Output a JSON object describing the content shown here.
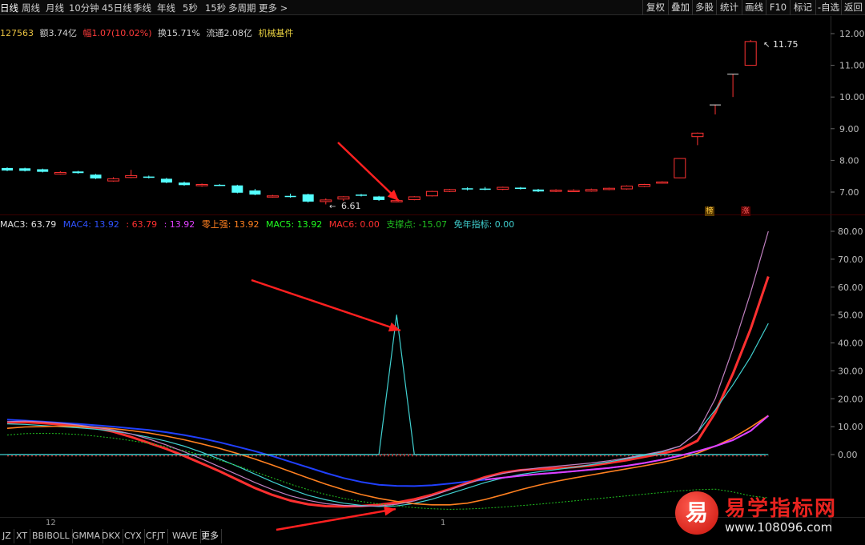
{
  "toolbar": {
    "periods": [
      "日线",
      "周线",
      "月线",
      "10分钟",
      "45日线",
      "季线",
      "年线",
      "5秒",
      "15秒",
      "多周期",
      "更多 >"
    ],
    "right_buttons": [
      "复权",
      "叠加",
      "多股",
      "统计",
      "画线",
      "F10",
      "标记",
      "-自选",
      "返回"
    ]
  },
  "info": {
    "volume": "127563",
    "amount": "额3.74亿",
    "change": "幅1.07(10.02%)",
    "turnover": "换15.71%",
    "float": "流通2.08亿",
    "sector": "机械基件"
  },
  "colors": {
    "up": "#ff3232",
    "down": "#54ffff",
    "mac3": "#ffffff",
    "mac4": "#2040ff",
    "mac5": "#00ff00",
    "mac6": "#ff3030",
    "cyan": "#40d0d0",
    "pink": "#c080c0",
    "magenta": "#e040ff",
    "orange": "#ff8020",
    "dotgreen": "#20c020",
    "arrow": "#ff2020"
  },
  "indicator": {
    "mac3": "MAC3: 63.79",
    "mac4": "MAC4: 13.92",
    "v3": ": 63.79",
    "v4": ": 13.92",
    "zero": "零上强: 13.92",
    "mac5": "MAC5: 13.92",
    "mac6": "MAC6: 0.00",
    "support": "支撑点: -15.07",
    "free": "免年指标: 0.00"
  },
  "tabs": [
    "JZ",
    "XT",
    "BBIBOLL",
    "GMMA",
    "DKX",
    "CYX",
    "CFJT",
    "WAVE",
    "更多"
  ],
  "dates": [
    "12",
    "1"
  ],
  "badges": [
    "榜",
    "涨"
  ],
  "watermark": {
    "logo_char": "易",
    "title": "易学指标网",
    "url": "www.108096.com"
  },
  "chart_data": [
    {
      "type": "candlestick",
      "ylim": [
        6.5,
        12.2
      ],
      "yticks": [
        "12.00",
        "11.00",
        "10.00",
        "9.00",
        "8.00",
        "7.00"
      ],
      "annotations": {
        "high": "11.75",
        "low": "6.61"
      },
      "candles": [
        {
          "o": 7.76,
          "c": 7.68,
          "h": 7.78,
          "l": 7.66
        },
        {
          "o": 7.75,
          "c": 7.67,
          "h": 7.77,
          "l": 7.65
        },
        {
          "o": 7.72,
          "c": 7.64,
          "h": 7.74,
          "l": 7.62
        },
        {
          "o": 7.57,
          "c": 7.62,
          "h": 7.66,
          "l": 7.55
        },
        {
          "o": 7.65,
          "c": 7.6,
          "h": 7.67,
          "l": 7.58
        },
        {
          "o": 7.55,
          "c": 7.43,
          "h": 7.57,
          "l": 7.41
        },
        {
          "o": 7.35,
          "c": 7.42,
          "h": 7.47,
          "l": 7.33
        },
        {
          "o": 7.46,
          "c": 7.52,
          "h": 7.7,
          "l": 7.44
        },
        {
          "o": 7.49,
          "c": 7.45,
          "h": 7.52,
          "l": 7.43
        },
        {
          "o": 7.42,
          "c": 7.3,
          "h": 7.45,
          "l": 7.28
        },
        {
          "o": 7.3,
          "c": 7.22,
          "h": 7.33,
          "l": 7.2
        },
        {
          "o": 7.2,
          "c": 7.24,
          "h": 7.27,
          "l": 7.17
        },
        {
          "o": 7.23,
          "c": 7.21,
          "h": 7.25,
          "l": 7.19
        },
        {
          "o": 7.21,
          "c": 6.98,
          "h": 7.23,
          "l": 6.96
        },
        {
          "o": 7.05,
          "c": 6.92,
          "h": 7.1,
          "l": 6.9
        },
        {
          "o": 6.85,
          "c": 6.88,
          "h": 6.91,
          "l": 6.83
        },
        {
          "o": 6.88,
          "c": 6.86,
          "h": 6.95,
          "l": 6.82
        },
        {
          "o": 6.93,
          "c": 6.7,
          "h": 6.95,
          "l": 6.67
        },
        {
          "o": 6.7,
          "c": 6.75,
          "h": 6.8,
          "l": 6.61
        },
        {
          "o": 6.78,
          "c": 6.85,
          "h": 6.87,
          "l": 6.72
        },
        {
          "o": 6.92,
          "c": 6.9,
          "h": 6.94,
          "l": 6.86
        },
        {
          "o": 6.86,
          "c": 6.75,
          "h": 6.88,
          "l": 6.72
        },
        {
          "o": 6.72,
          "c": 6.73,
          "h": 6.78,
          "l": 6.68
        },
        {
          "o": 6.76,
          "c": 6.85,
          "h": 6.87,
          "l": 6.74
        },
        {
          "o": 6.88,
          "c": 7.02,
          "h": 7.04,
          "l": 6.86
        },
        {
          "o": 7.02,
          "c": 7.08,
          "h": 7.1,
          "l": 7.0
        },
        {
          "o": 7.12,
          "c": 7.1,
          "h": 7.15,
          "l": 7.05
        },
        {
          "o": 7.11,
          "c": 7.09,
          "h": 7.16,
          "l": 7.06
        },
        {
          "o": 7.09,
          "c": 7.15,
          "h": 7.17,
          "l": 7.06
        },
        {
          "o": 7.14,
          "c": 7.1,
          "h": 7.16,
          "l": 7.08
        },
        {
          "o": 7.08,
          "c": 7.02,
          "h": 7.1,
          "l": 7.0
        },
        {
          "o": 7.04,
          "c": 7.06,
          "h": 7.09,
          "l": 7.0
        },
        {
          "o": 7.04,
          "c": 7.05,
          "h": 7.09,
          "l": 7.0
        },
        {
          "o": 7.03,
          "c": 7.08,
          "h": 7.11,
          "l": 7.01
        },
        {
          "o": 7.08,
          "c": 7.12,
          "h": 7.14,
          "l": 7.06
        },
        {
          "o": 7.1,
          "c": 7.19,
          "h": 7.21,
          "l": 7.08
        },
        {
          "o": 7.18,
          "c": 7.24,
          "h": 7.26,
          "l": 7.16
        },
        {
          "o": 7.28,
          "c": 7.32,
          "h": 7.34,
          "l": 7.27
        },
        {
          "o": 7.45,
          "c": 8.06,
          "h": 8.06,
          "l": 7.44
        },
        {
          "o": 8.75,
          "c": 8.86,
          "h": 8.88,
          "l": 8.48
        },
        {
          "o": 9.75,
          "c": 9.75,
          "h": 9.75,
          "l": 9.45
        },
        {
          "o": 10.72,
          "c": 10.72,
          "h": 10.72,
          "l": 10.0
        },
        {
          "o": 11.0,
          "c": 11.75,
          "h": 11.8,
          "l": 11.0
        }
      ]
    },
    {
      "type": "line",
      "ylim": [
        -19,
        81
      ],
      "yticks": [
        "80.00",
        "70.00",
        "60.00",
        "50.00",
        "40.00",
        "30.00",
        "20.00",
        "10.00",
        "0.00"
      ],
      "series": [
        {
          "name": "MAC6",
          "values": [
            -0.5,
            -0.5,
            -0.5,
            -0.5,
            -0.5,
            -0.5,
            -0.5,
            -0.5,
            -0.5,
            -0.5,
            -0.5,
            -0.5,
            -0.5,
            -0.5,
            -0.5,
            -0.5,
            -0.5,
            -0.5,
            -0.5,
            -0.5,
            -0.5,
            -0.5,
            -0.5,
            -0.5,
            -0.5,
            -0.5,
            -0.5,
            -0.5,
            -0.5,
            -0.5,
            -0.5,
            -0.5,
            -0.5,
            -0.5,
            -0.5,
            -0.5,
            -0.5,
            -0.5,
            -0.5,
            -0.5,
            -0.5,
            -0.5,
            -0.5,
            -0.5
          ]
        },
        {
          "name": "MAC4",
          "values": [
            12.5,
            12.2,
            11.8,
            11.4,
            11.0,
            10.5,
            10.0,
            9.4,
            8.8,
            8.0,
            7.0,
            5.8,
            4.4,
            2.8,
            1.2,
            -0.6,
            -2.6,
            -4.6,
            -6.6,
            -8.4,
            -9.8,
            -10.8,
            -11.2,
            -11.3,
            -11.0,
            -10.4,
            -9.7,
            -9.0,
            -8.3,
            -7.6,
            -7.0,
            -6.5,
            -6.0,
            -5.4,
            -4.8,
            -4.0,
            -3.0,
            -1.8,
            -0.4,
            1.2,
            3.0,
            5.2,
            8.5,
            13.9
          ]
        },
        {
          "name": "",
          "values": [
            11.5,
            11.6,
            11.3,
            10.8,
            10.2,
            9.5,
            8.2,
            6.3,
            4.2,
            2.0,
            -0.5,
            -3.2,
            -6.0,
            -9.0,
            -12.0,
            -14.5,
            -16.5,
            -17.8,
            -18.5,
            -18.6,
            -18.4,
            -18.0,
            -17.2,
            -16.0,
            -14.4,
            -12.4,
            -10.2,
            -8.1,
            -6.5,
            -5.6,
            -5.2,
            -4.9,
            -4.5,
            -3.9,
            -3.0,
            -2.0,
            -0.8,
            0.4,
            1.8,
            5.0,
            15.0,
            29.0,
            45.0,
            63.8
          ]
        },
        {
          "name": "MAC3",
          "values": [
            11.0,
            10.8,
            10.4,
            10.0,
            9.6,
            9.1,
            8.4,
            7.4,
            6.2,
            4.8,
            3.0,
            0.8,
            -1.6,
            -4.2,
            -7.0,
            -9.8,
            -12.4,
            -14.6,
            -16.2,
            -17.4,
            -18.2,
            -18.6,
            -18.4,
            -17.5,
            -16.0,
            -14.0,
            -12.0,
            -10.0,
            -8.4,
            -7.1,
            -6.2,
            -5.4,
            -4.6,
            -3.6,
            -2.6,
            -1.5,
            -0.3,
            1.0,
            3.0,
            8.0,
            16.0,
            25.0,
            35.0,
            47.0
          ]
        },
        {
          "name": "MAC5",
          "values": [
            7.0,
            7.5,
            7.6,
            7.5,
            7.2,
            6.6,
            5.9,
            5.0,
            4.0,
            2.8,
            1.4,
            -0.2,
            -2.0,
            -4.0,
            -6.2,
            -8.4,
            -10.6,
            -12.6,
            -14.3,
            -15.7,
            -16.8,
            -17.7,
            -18.4,
            -19.0,
            -19.4,
            -19.6,
            -19.5,
            -19.2,
            -18.8,
            -18.3,
            -17.8,
            -17.2,
            -16.6,
            -16.0,
            -15.4,
            -14.8,
            -14.2,
            -13.6,
            -13.0,
            -12.6,
            -12.4,
            -13.4,
            -14.8,
            -15.5
          ]
        },
        {
          "name": "",
          "values": [
            9.4,
            9.9,
            10.0,
            10.2,
            10.1,
            9.8,
            9.3,
            8.6,
            7.7,
            6.6,
            5.3,
            3.8,
            2.2,
            0.4,
            -1.6,
            -3.8,
            -6.1,
            -8.4,
            -10.6,
            -12.6,
            -14.3,
            -15.7,
            -16.8,
            -17.6,
            -18.0,
            -18.0,
            -17.4,
            -16.1,
            -14.4,
            -12.6,
            -11.0,
            -9.6,
            -8.4,
            -7.3,
            -6.2,
            -5.1,
            -4.0,
            -2.8,
            -1.4,
            0.5,
            3.0,
            6.0,
            9.8,
            14.0
          ]
        },
        {
          "name": "",
          "values": [
            11.8,
            12.0,
            11.7,
            11.2,
            10.6,
            9.8,
            8.8,
            7.4,
            5.6,
            3.4,
            1.0,
            -1.6,
            -4.4,
            -7.2,
            -10.0,
            -12.6,
            -14.8,
            -16.4,
            -17.6,
            -18.2,
            -18.5,
            -18.4,
            -17.8,
            -16.6,
            -14.8,
            -12.6,
            -10.4,
            -8.4,
            -6.8,
            -5.6,
            -4.8,
            -4.2,
            -3.6,
            -3.0,
            -2.2,
            -1.2,
            0.0,
            1.2,
            3.0,
            8.0,
            20.0,
            38.0,
            58.0,
            80.0
          ]
        },
        {
          "name": "",
          "values": [
            -15.0,
            -15.0,
            -15.0,
            -15.0,
            -15.0,
            -15.0,
            -15.0,
            -15.0,
            -15.0,
            -15.0,
            -15.0,
            -15.0,
            -15.0,
            -15.0,
            -15.0,
            -15.0,
            -15.0,
            -15.0,
            -15.0,
            -15.0,
            -15.0,
            -15.0,
            -15.0,
            -15.0,
            -15.0,
            -15.0,
            -15.0,
            -15.0,
            -15.0,
            -15.0,
            -15.0,
            -15.0,
            -15.0,
            -15.0,
            -15.0,
            -15.0,
            -15.0,
            -15.0,
            -15.0,
            -15.0,
            -15.0,
            -15.0,
            -15.0,
            -15.0
          ]
        },
        {
          "name": "",
          "values": [
            0,
            0,
            0,
            0,
            0,
            0,
            0,
            0,
            0,
            0,
            0,
            0,
            0,
            0,
            0,
            0,
            0,
            0,
            0,
            0,
            0,
            0,
            50,
            0,
            0,
            0,
            0,
            0,
            0,
            0,
            0,
            0,
            0,
            0,
            0,
            0,
            0,
            0,
            0,
            0,
            0,
            0,
            0,
            0
          ]
        }
      ]
    }
  ]
}
